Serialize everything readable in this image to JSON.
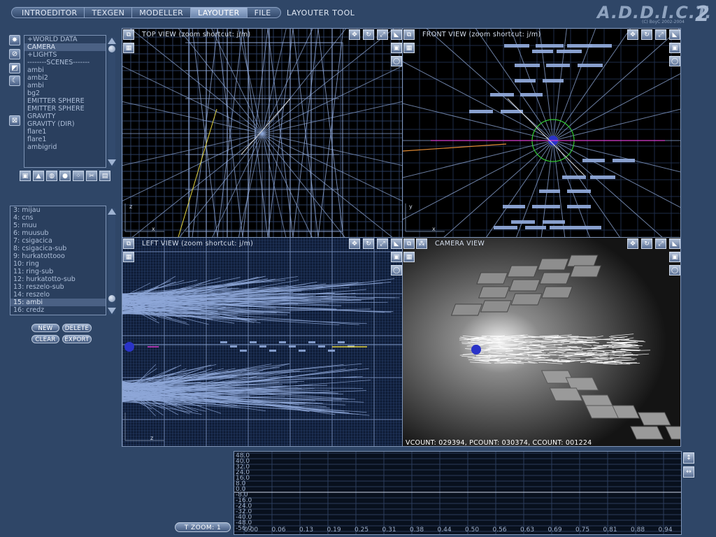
{
  "menu": [
    {
      "label": "INTROEDITOR",
      "active": false
    },
    {
      "label": "TEXGEN",
      "active": false
    },
    {
      "label": "MODELLER",
      "active": false
    },
    {
      "label": "LAYOUTER",
      "active": true
    },
    {
      "label": "FILE",
      "active": false
    }
  ],
  "tool_title": "LAYOUTER TOOL",
  "logo": {
    "text": "A.D.D.I.C.T.",
    "version": "2",
    "copyright": "(C) BoyC 2002-2004"
  },
  "side_buttons": [
    "sun-icon",
    "forbid-icon",
    "gradient-icon",
    "moon-icon",
    "close-box-icon"
  ],
  "world_list": {
    "items": [
      "+WORLD DATA",
      "CAMERA",
      "+LIGHTS",
      "--------SCENES-------",
      "ambi",
      "ambi2",
      "ambi",
      "bg2",
      "EMITTER SPHERE",
      "EMITTER SPHERE",
      "GRAVITY",
      "GRAVITY (DIR)",
      "flare1",
      "flare1",
      "ambigrid"
    ],
    "selected_index": 1
  },
  "object_tools": [
    "cube-icon",
    "cone-icon",
    "cylinder-icon",
    "sphere-icon",
    "particle-icon",
    "scissors-icon",
    "save-icon"
  ],
  "scene_list": {
    "items": [
      "3: mijau",
      "4: cns",
      "5: muu",
      "6: muusub",
      "7: csigacica",
      "8: csigacica-sub",
      "9: hurkatottooo",
      "10: ring",
      "11: ring-sub",
      "12: hurkatotto-sub",
      "13: reszelo-sub",
      "14: reszelo",
      "15: ambi",
      "16: credz"
    ],
    "selected_index": 12
  },
  "buttons": {
    "new": "NEW",
    "delete": "DELETE",
    "clear": "CLEAR",
    "export": "EXPORT"
  },
  "viewports": {
    "top": {
      "label": "TOP VIEW (zoom shortcut: j/m)",
      "axis_a": "z",
      "axis_b": "x"
    },
    "front": {
      "label": "FRONT VIEW (zoom shortcut: j/m)",
      "axis_a": "y",
      "axis_b": "x"
    },
    "left": {
      "label": "LEFT VIEW (zoom shortcut: j/m)",
      "axis_a": "z"
    },
    "camera": {
      "label": "CAMERA VIEW",
      "stats": "VCOUNT: 029394, PCOUNT: 030374, CCOUNT: 001224"
    }
  },
  "timeline": {
    "zoom_label": "T ZOOM: 1",
    "y_labels": [
      "48.0",
      "40.0",
      "32.0",
      "24.0",
      "16.0",
      "8.0",
      "0.0",
      "-8.0",
      "-16.0",
      "-24.0",
      "-32.0",
      "-40.0",
      "-48.0",
      "-56.0"
    ],
    "x_labels": [
      "0.00",
      "0.06",
      "0.13",
      "0.19",
      "0.25",
      "0.31",
      "0.38",
      "0.44",
      "0.50",
      "0.56",
      "0.63",
      "0.69",
      "0.75",
      "0.81",
      "0.88",
      "0.94"
    ]
  },
  "colors": {
    "background": "#2f4667",
    "wire": "#8fa8d8",
    "accent_yellow": "#e6d640",
    "accent_magenta": "#d83cd0",
    "accent_green": "#32c832"
  }
}
